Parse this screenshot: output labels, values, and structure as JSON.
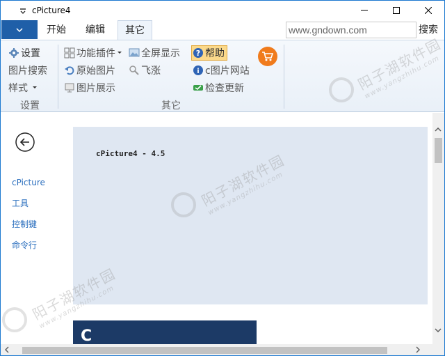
{
  "window": {
    "title": "cPicture4"
  },
  "tabs": [
    {
      "label": "开始"
    },
    {
      "label": "编辑"
    },
    {
      "label": "其它"
    }
  ],
  "search": {
    "value": "www.gndown.com",
    "button_label": "搜索"
  },
  "ribbon": {
    "group_settings": {
      "label": "设置",
      "settings": "设置",
      "image_search": "图片搜索",
      "style": "样式"
    },
    "group_other": {
      "label": "其它",
      "plugins": "功能插件",
      "fullscreen": "全屏显示",
      "original_image": "原始图片",
      "fly": "飞涨",
      "image_show": "图片展示",
      "help": "帮助",
      "website": "c图片网站",
      "check_update": "检查更新"
    }
  },
  "content": {
    "version_text": "cPicture4 - 4.5",
    "nav": [
      {
        "label": "cPicture"
      },
      {
        "label": "工具"
      },
      {
        "label": "控制键"
      },
      {
        "label": "命令行"
      }
    ],
    "tile_letter": "C"
  },
  "watermark": {
    "text": "阳子湖软件园",
    "url": "www.yangzhihu.com"
  },
  "colors": {
    "accent": "#1f5fa8",
    "link": "#2b6fbe",
    "panel": "#dfe7f2",
    "tile": "#1c3a66",
    "cart": "#f07b1c"
  }
}
